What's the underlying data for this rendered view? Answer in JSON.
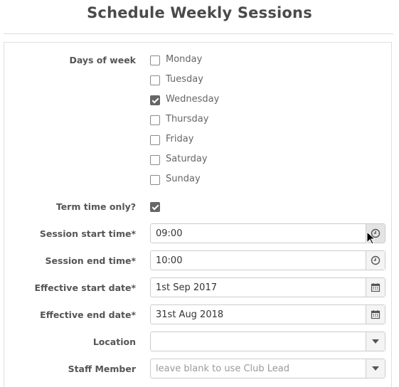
{
  "title": "Schedule Weekly Sessions",
  "days": {
    "label": "Days of week",
    "options": [
      {
        "label": "Monday",
        "checked": false
      },
      {
        "label": "Tuesday",
        "checked": false
      },
      {
        "label": "Wednesday",
        "checked": true
      },
      {
        "label": "Thursday",
        "checked": false
      },
      {
        "label": "Friday",
        "checked": false
      },
      {
        "label": "Saturday",
        "checked": false
      },
      {
        "label": "Sunday",
        "checked": false
      }
    ]
  },
  "term_time": {
    "label": "Term time only?",
    "checked": true
  },
  "session_start": {
    "label": "Session start time*",
    "value": "09:00",
    "icon": "clock-icon"
  },
  "session_end": {
    "label": "Session end time*",
    "value": "10:00",
    "icon": "clock-icon"
  },
  "effective_start": {
    "label": "Effective start date*",
    "value": "1st Sep 2017",
    "icon": "calendar-icon"
  },
  "effective_end": {
    "label": "Effective end date*",
    "value": "31st Aug 2018",
    "icon": "calendar-icon"
  },
  "location": {
    "label": "Location",
    "value": "",
    "icon": "caret-down-icon"
  },
  "staff_member": {
    "label": "Staff Member",
    "value": "",
    "placeholder": "leave blank to use Club Lead",
    "icon": "caret-down-icon"
  }
}
